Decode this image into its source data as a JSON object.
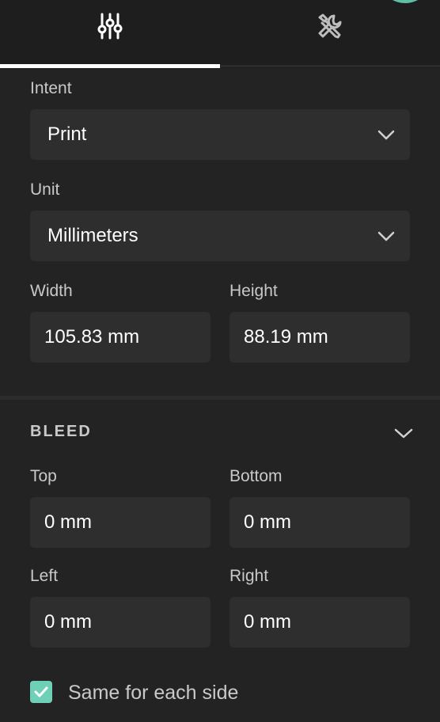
{
  "tabs": [
    {
      "icon": "sliders-icon",
      "active": true
    },
    {
      "icon": "tools-icon",
      "active": false
    }
  ],
  "intent": {
    "label": "Intent",
    "value": "Print"
  },
  "unit": {
    "label": "Unit",
    "value": "Millimeters"
  },
  "size": {
    "width_label": "Width",
    "width_value": "105.83 mm",
    "height_label": "Height",
    "height_value": "88.19 mm"
  },
  "bleed": {
    "title": "BLEED",
    "top_label": "Top",
    "top_value": "0 mm",
    "bottom_label": "Bottom",
    "bottom_value": "0 mm",
    "left_label": "Left",
    "left_value": "0 mm",
    "right_label": "Right",
    "right_value": "0 mm",
    "same_label": "Same for each side",
    "same_checked": true
  },
  "colors": {
    "accent": "#6fd0b8",
    "background": "#232323",
    "field": "#2e2e2e"
  }
}
